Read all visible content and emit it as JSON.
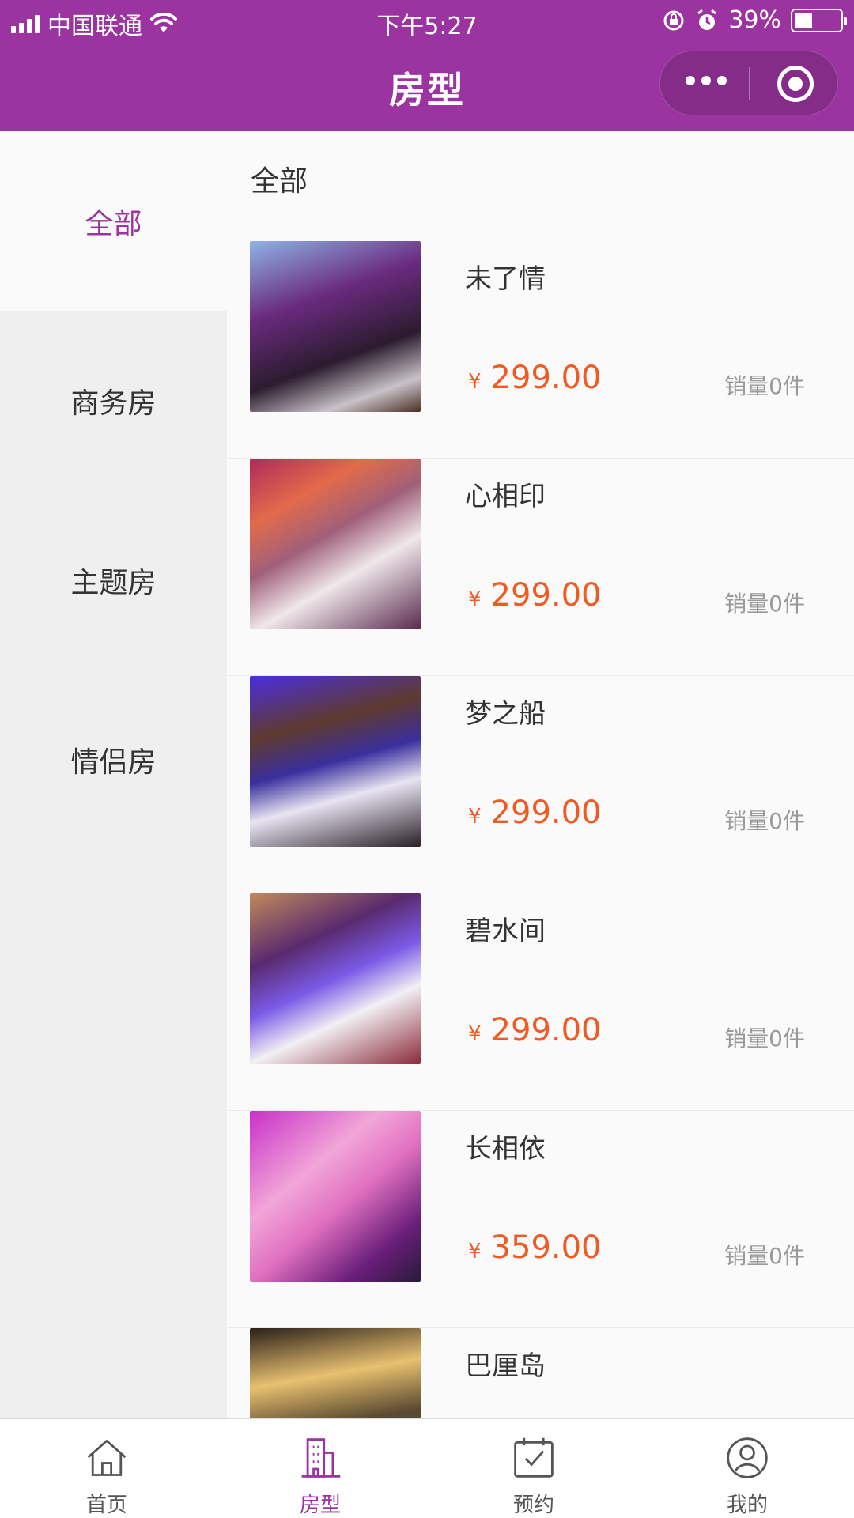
{
  "status_bar": {
    "carrier": "中国联通",
    "time": "下午5:27",
    "battery_percent": "39%",
    "battery_level": 0.39
  },
  "nav": {
    "title": "房型"
  },
  "sidebar": {
    "items": [
      {
        "label": "全部",
        "active": true
      },
      {
        "label": "商务房",
        "active": false
      },
      {
        "label": "主题房",
        "active": false
      },
      {
        "label": "情侣房",
        "active": false
      }
    ]
  },
  "main": {
    "section_title": "全部",
    "rooms": [
      {
        "name": "未了情",
        "currency": "¥",
        "price": "299.00",
        "sales": "销量0件"
      },
      {
        "name": "心相印",
        "currency": "¥",
        "price": "299.00",
        "sales": "销量0件"
      },
      {
        "name": "梦之船",
        "currency": "¥",
        "price": "299.00",
        "sales": "销量0件"
      },
      {
        "name": "碧水间",
        "currency": "¥",
        "price": "299.00",
        "sales": "销量0件"
      },
      {
        "name": "长相依",
        "currency": "¥",
        "price": "359.00",
        "sales": "销量0件"
      },
      {
        "name": "巴厘岛",
        "currency": "¥",
        "price": "",
        "sales": ""
      }
    ]
  },
  "tab_bar": {
    "tabs": [
      {
        "label": "首页",
        "icon": "home-icon",
        "active": false
      },
      {
        "label": "房型",
        "icon": "building-icon",
        "active": true
      },
      {
        "label": "预约",
        "icon": "calendar-check-icon",
        "active": false
      },
      {
        "label": "我的",
        "icon": "user-icon",
        "active": false
      }
    ]
  },
  "colors": {
    "brand": "#9b34a0",
    "price": "#f05a23"
  }
}
